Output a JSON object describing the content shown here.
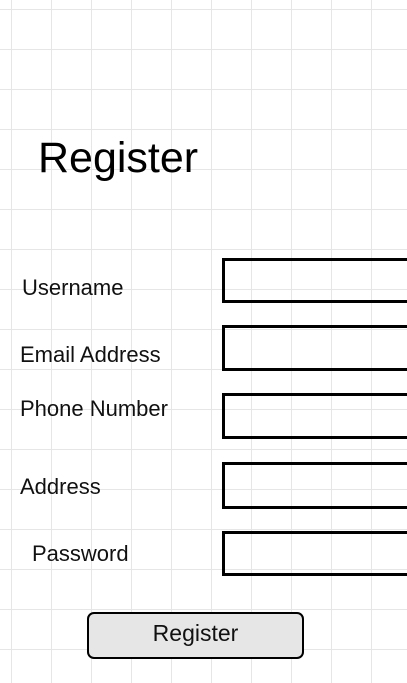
{
  "page": {
    "title": "Register"
  },
  "form": {
    "fields": [
      {
        "label": "Username",
        "value": "",
        "placeholder": ""
      },
      {
        "label": "Email Address",
        "value": "",
        "placeholder": ""
      },
      {
        "label": "Phone Number",
        "value": "",
        "placeholder": ""
      },
      {
        "label": "Address",
        "value": "",
        "placeholder": ""
      },
      {
        "label": "Password",
        "value": "",
        "placeholder": ""
      }
    ],
    "submit_label": "Register"
  },
  "colors": {
    "background": "#ffffff",
    "grid_line": "#e6e6e6",
    "field_border": "#000000",
    "button_fill": "#e6e6e6"
  }
}
